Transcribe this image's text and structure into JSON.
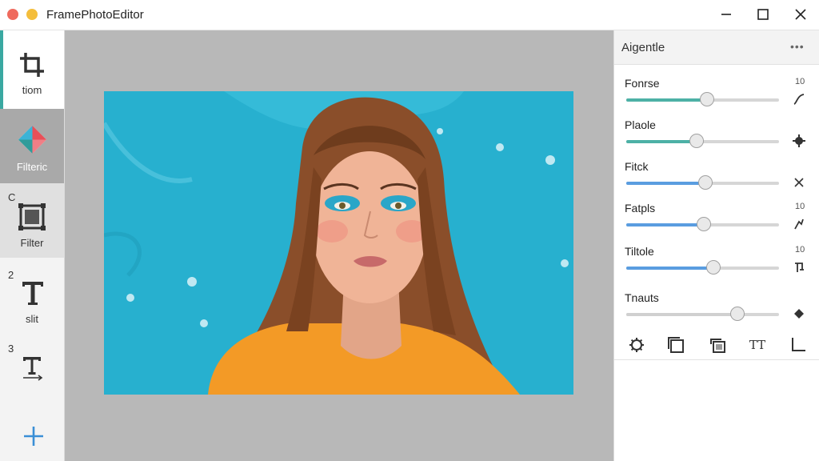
{
  "app": {
    "title": "FramePhotoEditor",
    "controls": [
      "minimize",
      "maximize",
      "close"
    ]
  },
  "left_toolbar": {
    "tools": [
      {
        "id": "crop",
        "label": "tiom",
        "number": "",
        "icon": "crop-icon",
        "state": "active"
      },
      {
        "id": "filter1",
        "label": "Filteric",
        "number": "",
        "icon": "prism-icon",
        "state": "selected"
      },
      {
        "id": "filter2",
        "label": "Filter",
        "number": "C",
        "icon": "frame-icon",
        "state": "hover"
      },
      {
        "id": "text1",
        "label": "slit",
        "number": "2",
        "icon": "text-icon",
        "state": "normal"
      },
      {
        "id": "text2",
        "label": "",
        "number": "3",
        "icon": "text-baseline-icon",
        "state": "normal"
      }
    ],
    "add_icon": "plus-icon",
    "accent": "#3aa8a1"
  },
  "canvas": {
    "background": "#b8b8b8",
    "photo_icon": "portrait-photo"
  },
  "panel": {
    "title": "Aigentle",
    "more_label": "•••",
    "adjustments": [
      {
        "name": "Fonrse",
        "value": "10",
        "level": 0.53,
        "fill_color": "#4db1a6",
        "icon": "curve-icon"
      },
      {
        "name": "Plaole",
        "value": "",
        "level": 0.46,
        "fill_color": "#4db1a6",
        "icon": "gear-icon"
      },
      {
        "name": "Fitck",
        "value": "",
        "level": 0.52,
        "fill_color": "#5a9de0",
        "icon": "close-icon"
      },
      {
        "name": "Fatpls",
        "value": "10",
        "level": 0.51,
        "fill_color": "#5a9de0",
        "icon": "brush-icon"
      },
      {
        "name": "Tiltole",
        "value": "10",
        "level": 0.57,
        "fill_color": "#5a9de0",
        "icon": "tilt-icon"
      },
      {
        "name": "Tnauts",
        "value": "",
        "level": 0.73,
        "fill_color": "#d0d0d0",
        "icon": "diamond-icon"
      }
    ],
    "bottom_icons": [
      {
        "name": "settings-icon"
      },
      {
        "name": "layers-icon"
      },
      {
        "name": "transform-icon"
      },
      {
        "name": "text-size-icon",
        "label": "TT"
      },
      {
        "name": "corner-icon"
      }
    ]
  }
}
